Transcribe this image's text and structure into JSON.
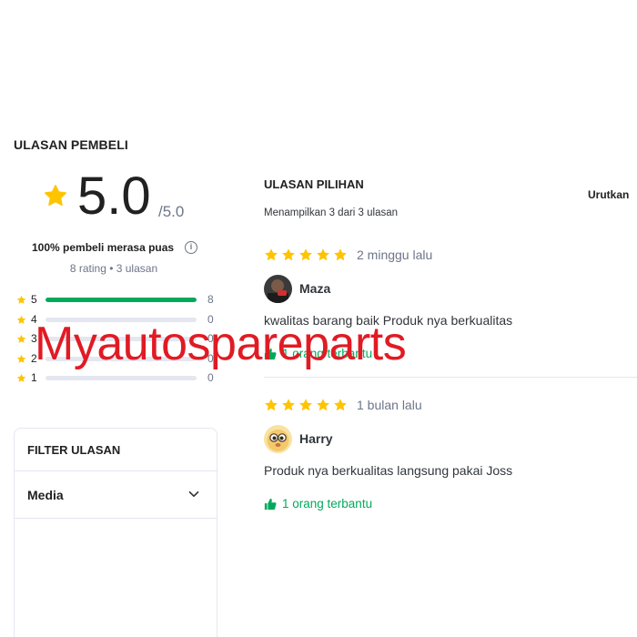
{
  "header": {
    "title": "ULASAN PEMBELI"
  },
  "summary": {
    "score": "5.0",
    "max": "/5.0",
    "satisfied": "100% pembeli merasa puas",
    "info_icon": "info-icon",
    "counts": "8 rating • 3 ulasan"
  },
  "distribution": [
    {
      "star": "5",
      "count": "8",
      "fraction": 1.0
    },
    {
      "star": "4",
      "count": "0",
      "fraction": 0
    },
    {
      "star": "3",
      "count": "0",
      "fraction": 0
    },
    {
      "star": "2",
      "count": "0",
      "fraction": 0
    },
    {
      "star": "1",
      "count": "0",
      "fraction": 0
    }
  ],
  "filter": {
    "title": "FILTER ULASAN",
    "media_label": "Media",
    "media_icon": "chevron-down-icon"
  },
  "reviews_section": {
    "title": "ULASAN PILIHAN",
    "sort_label": "Urutkan",
    "showing": "Menampilkan 3 dari 3 ulasan"
  },
  "reviews": [
    {
      "stars": 5,
      "time": "2 minggu lalu",
      "name": "Maza",
      "text": "kwalitas barang baik Produk nya berkualitas",
      "helpful": "1 orang terbantu"
    },
    {
      "stars": 5,
      "time": "1 bulan lalu",
      "name": "Harry",
      "text": "Produk nya berkualitas langsung pakai Joss",
      "helpful": "1 orang terbantu"
    }
  ],
  "watermark": {
    "text": "Myautospareparts"
  },
  "colors": {
    "star": "#ffc400",
    "green": "#00aa5b",
    "track": "#e4e7f0",
    "watermark": "#e01b24"
  }
}
